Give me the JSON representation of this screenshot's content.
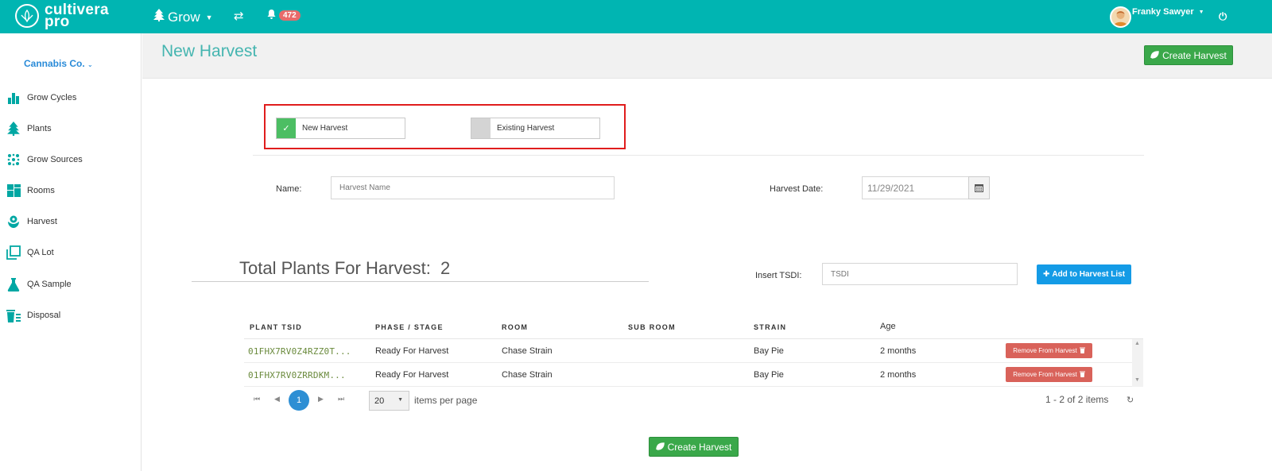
{
  "topbar": {
    "logo_line1": "cultivera",
    "logo_line2": "pro",
    "grow_label": "Grow",
    "notification_count": "472",
    "user_name": "Franky Sawyer"
  },
  "sidebar": {
    "company": "Cannabis Co.",
    "items": [
      {
        "label": "Grow Cycles",
        "icon": "bar-chart-icon"
      },
      {
        "label": "Plants",
        "icon": "tree-icon"
      },
      {
        "label": "Grow Sources",
        "icon": "seeds-icon"
      },
      {
        "label": "Rooms",
        "icon": "rooms-grid-icon"
      },
      {
        "label": "Harvest",
        "icon": "harvest-flower-icon"
      },
      {
        "label": "QA Lot",
        "icon": "copy-squares-icon"
      },
      {
        "label": "QA Sample",
        "icon": "flask-icon"
      },
      {
        "label": "Disposal",
        "icon": "trash-list-icon"
      }
    ]
  },
  "header": {
    "title": "New Harvest",
    "create_button": "Create Harvest"
  },
  "toggles": {
    "new_harvest": "New Harvest",
    "existing_harvest": "Existing Harvest",
    "selected": "new_harvest"
  },
  "form": {
    "name_label": "Name:",
    "name_placeholder": "Harvest Name",
    "date_label": "Harvest Date:",
    "date_value": "11/29/2021"
  },
  "plants": {
    "total_label": "Total Plants For Harvest:",
    "total_value": "2",
    "tsdi_label": "Insert TSDI:",
    "tsdi_placeholder": "TSDI",
    "add_button": "Add to Harvest List"
  },
  "grid": {
    "headers": [
      "PLANT TSID",
      "PHASE / STAGE",
      "ROOM",
      "SUB ROOM",
      "STRAIN",
      "Age"
    ],
    "rows": [
      {
        "tsid": "01FHX7RV0Z4RZZ0T...",
        "phase": "Ready For Harvest",
        "room": "Chase Strain",
        "sub_room": "",
        "strain": "Bay Pie",
        "age": "2 months",
        "action": "Remove From Harvest"
      },
      {
        "tsid": "01FHX7RV0ZRRDKM...",
        "phase": "Ready For Harvest",
        "room": "Chase Strain",
        "sub_room": "",
        "strain": "Bay Pie",
        "age": "2 months",
        "action": "Remove From Harvest"
      }
    ]
  },
  "pager": {
    "current_page": "1",
    "page_size": "20",
    "page_size_label": "items per page",
    "info": "1 - 2 of 2 items"
  },
  "footer": {
    "create_button": "Create Harvest"
  },
  "colors": {
    "topbar": "#00b5b2",
    "accent_green": "#3aa84a",
    "accent_blue": "#149be6",
    "danger": "#d9625a",
    "highlight_box": "#e01d1d"
  }
}
